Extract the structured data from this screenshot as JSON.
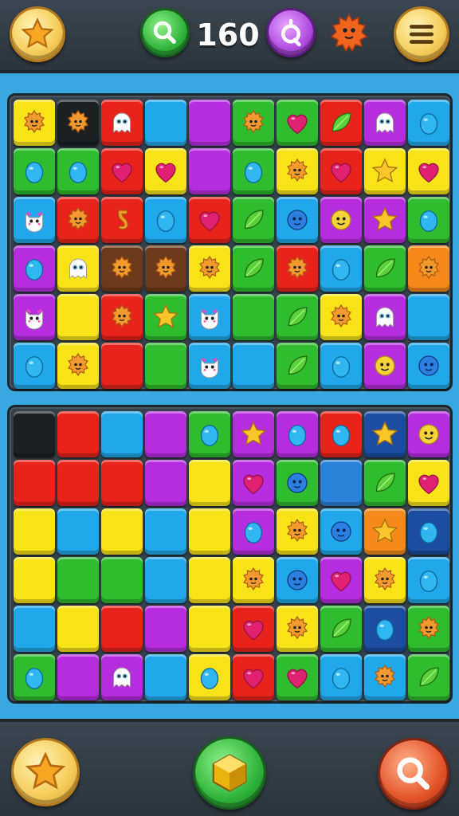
{
  "header": {
    "score": "160",
    "icons": [
      "star-icon",
      "magnifier-icon",
      "magnifier-alt-icon",
      "sunny-creature-icon",
      "menu-icon"
    ]
  },
  "footer": {
    "icons": [
      "star-icon",
      "cube-icon",
      "magnifier-icon"
    ]
  },
  "palette": {
    "yellow": "#f8e318",
    "green": "#2fbc2e",
    "red": "#e8231b",
    "blue": "#20a8ea",
    "purple": "#b62de0",
    "orange": "#f58a1a",
    "black": "#1d2023",
    "brown": "#6b3a1a",
    "navy": "#1c4da0",
    "teal": "#2a83d8"
  },
  "boards": [
    {
      "rows": [
        [
          [
            "yellow",
            "sun"
          ],
          [
            "black",
            "sun"
          ],
          [
            "red",
            "ghost"
          ],
          [
            "blue",
            ""
          ],
          [
            "purple",
            ""
          ],
          [
            "green",
            "sun"
          ],
          [
            "green",
            "heart"
          ],
          [
            "red",
            "leaf"
          ],
          [
            "purple",
            "ghost"
          ],
          [
            "blue",
            "egg"
          ]
        ],
        [
          [
            "green",
            "egg"
          ],
          [
            "green",
            "egg"
          ],
          [
            "red",
            "heart"
          ],
          [
            "yellow",
            "heart"
          ],
          [
            "purple",
            ""
          ],
          [
            "green",
            "egg"
          ],
          [
            "yellow",
            "sun"
          ],
          [
            "red",
            "heart"
          ],
          [
            "yellow",
            "star"
          ],
          [
            "yellow",
            "heart"
          ]
        ],
        [
          [
            "blue",
            "cat"
          ],
          [
            "red",
            "sun"
          ],
          [
            "red",
            "seahorse"
          ],
          [
            "blue",
            "egg"
          ],
          [
            "red",
            "heart"
          ],
          [
            "green",
            "leaf"
          ],
          [
            "blue",
            "blob"
          ],
          [
            "purple",
            "smile"
          ],
          [
            "purple",
            "star"
          ],
          [
            "green",
            "egg"
          ]
        ],
        [
          [
            "purple",
            "egg"
          ],
          [
            "yellow",
            "ghost"
          ],
          [
            "brown",
            "sun"
          ],
          [
            "brown",
            "sun"
          ],
          [
            "yellow",
            "sun"
          ],
          [
            "green",
            "leaf"
          ],
          [
            "red",
            "sun"
          ],
          [
            "blue",
            "egg"
          ],
          [
            "green",
            "leaf"
          ],
          [
            "orange",
            "sun"
          ]
        ],
        [
          [
            "purple",
            "cat"
          ],
          [
            "yellow",
            ""
          ],
          [
            "red",
            "sun"
          ],
          [
            "green",
            "star"
          ],
          [
            "blue",
            "cat"
          ],
          [
            "green",
            ""
          ],
          [
            "green",
            "leaf"
          ],
          [
            "yellow",
            "sun"
          ],
          [
            "purple",
            "ghost"
          ],
          [
            "blue",
            ""
          ]
        ],
        [
          [
            "blue",
            "egg"
          ],
          [
            "yellow",
            "sun"
          ],
          [
            "red",
            ""
          ],
          [
            "green",
            ""
          ],
          [
            "blue",
            "cat"
          ],
          [
            "blue",
            ""
          ],
          [
            "green",
            "leaf"
          ],
          [
            "blue",
            "egg"
          ],
          [
            "purple",
            "smile"
          ],
          [
            "blue",
            "blob"
          ]
        ]
      ]
    },
    {
      "rows": [
        [
          [
            "black",
            ""
          ],
          [
            "red",
            ""
          ],
          [
            "blue",
            ""
          ],
          [
            "purple",
            ""
          ],
          [
            "green",
            "egg"
          ],
          [
            "purple",
            "star"
          ],
          [
            "purple",
            "egg"
          ],
          [
            "red",
            "egg"
          ],
          [
            "navy",
            "star"
          ],
          [
            "purple",
            "smile"
          ]
        ],
        [
          [
            "red",
            ""
          ],
          [
            "red",
            ""
          ],
          [
            "red",
            ""
          ],
          [
            "purple",
            ""
          ],
          [
            "yellow",
            ""
          ],
          [
            "purple",
            "heart"
          ],
          [
            "green",
            "blob"
          ],
          [
            "teal",
            ""
          ],
          [
            "green",
            "leaf"
          ],
          [
            "yellow",
            "heart"
          ]
        ],
        [
          [
            "yellow",
            ""
          ],
          [
            "blue",
            ""
          ],
          [
            "yellow",
            ""
          ],
          [
            "blue",
            ""
          ],
          [
            "yellow",
            ""
          ],
          [
            "purple",
            "egg"
          ],
          [
            "yellow",
            "sun"
          ],
          [
            "blue",
            "blob"
          ],
          [
            "orange",
            "star"
          ],
          [
            "navy",
            "egg"
          ]
        ],
        [
          [
            "yellow",
            ""
          ],
          [
            "green",
            ""
          ],
          [
            "green",
            ""
          ],
          [
            "blue",
            ""
          ],
          [
            "yellow",
            ""
          ],
          [
            "yellow",
            "sun"
          ],
          [
            "blue",
            "blob"
          ],
          [
            "purple",
            "heart"
          ],
          [
            "yellow",
            "sun"
          ],
          [
            "blue",
            "egg"
          ]
        ],
        [
          [
            "blue",
            ""
          ],
          [
            "yellow",
            ""
          ],
          [
            "red",
            ""
          ],
          [
            "purple",
            ""
          ],
          [
            "yellow",
            ""
          ],
          [
            "red",
            "heart"
          ],
          [
            "yellow",
            "sun"
          ],
          [
            "green",
            "leaf"
          ],
          [
            "navy",
            "egg"
          ],
          [
            "green",
            "sun"
          ]
        ],
        [
          [
            "green",
            "egg"
          ],
          [
            "purple",
            ""
          ],
          [
            "purple",
            "ghost"
          ],
          [
            "blue",
            ""
          ],
          [
            "yellow",
            "egg"
          ],
          [
            "red",
            "heart"
          ],
          [
            "green",
            "heart"
          ],
          [
            "blue",
            "egg"
          ],
          [
            "blue",
            "sun"
          ],
          [
            "green",
            "leaf"
          ]
        ]
      ]
    }
  ]
}
